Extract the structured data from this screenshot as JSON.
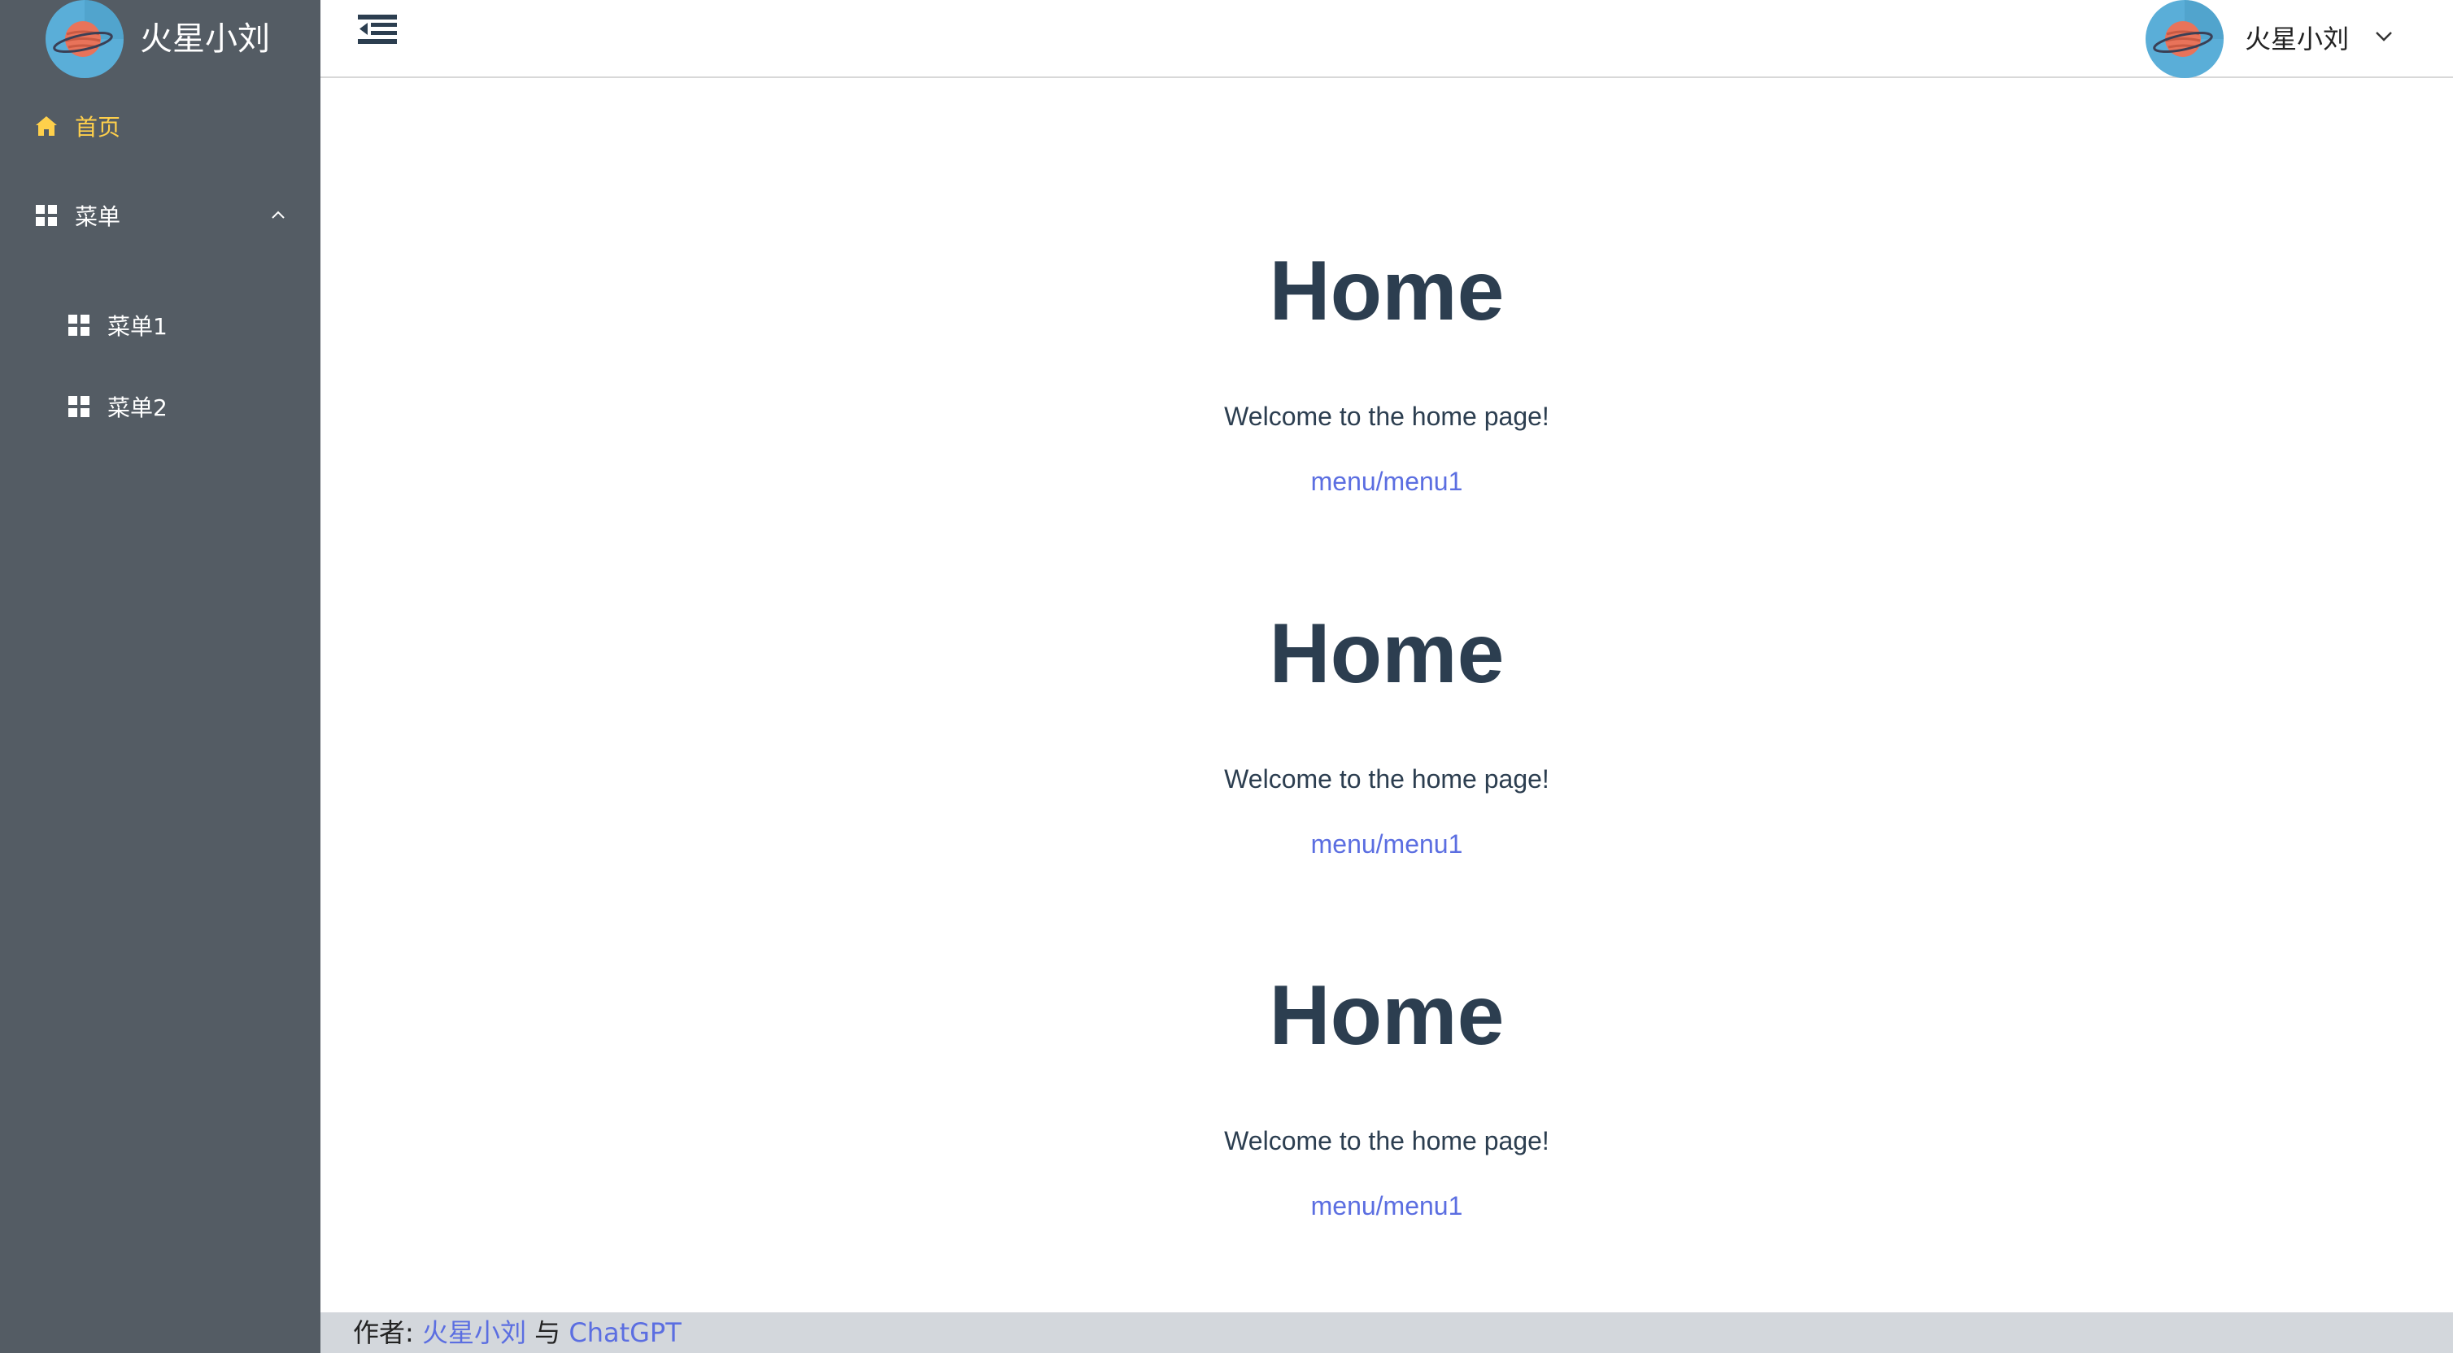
{
  "brand": {
    "title": "火星小刘",
    "avatar_icon": "planet-icon"
  },
  "sidebar": {
    "items": [
      {
        "label": "首页",
        "icon": "home-icon",
        "active": true
      },
      {
        "label": "菜单",
        "icon": "grid-icon",
        "expanded": true,
        "children": [
          {
            "label": "菜单1",
            "icon": "grid-icon"
          },
          {
            "label": "菜单2",
            "icon": "grid-icon"
          }
        ]
      }
    ]
  },
  "header": {
    "collapse_icon": "menu-collapse-icon",
    "user": {
      "name": "火星小刘",
      "avatar_icon": "planet-icon",
      "dropdown_icon": "chevron-down-icon"
    }
  },
  "main": {
    "sections": [
      {
        "title": "Home",
        "welcome": "Welcome to the home page!",
        "link": "menu/menu1"
      },
      {
        "title": "Home",
        "welcome": "Welcome to the home page!",
        "link": "menu/menu1"
      },
      {
        "title": "Home",
        "welcome": "Welcome to the home page!",
        "link": "menu/menu1"
      }
    ]
  },
  "footer": {
    "prefix": "作者: ",
    "author": "火星小刘",
    "conjunction": " 与 ",
    "collaborator": "ChatGPT"
  },
  "colors": {
    "sidebar_bg": "#545c64",
    "active_menu": "#ffd04b",
    "heading": "#2c3e50",
    "link": "#5b6ee1",
    "footer_bg": "#d3d7dc",
    "avatar_bg": "#5aaed8"
  }
}
